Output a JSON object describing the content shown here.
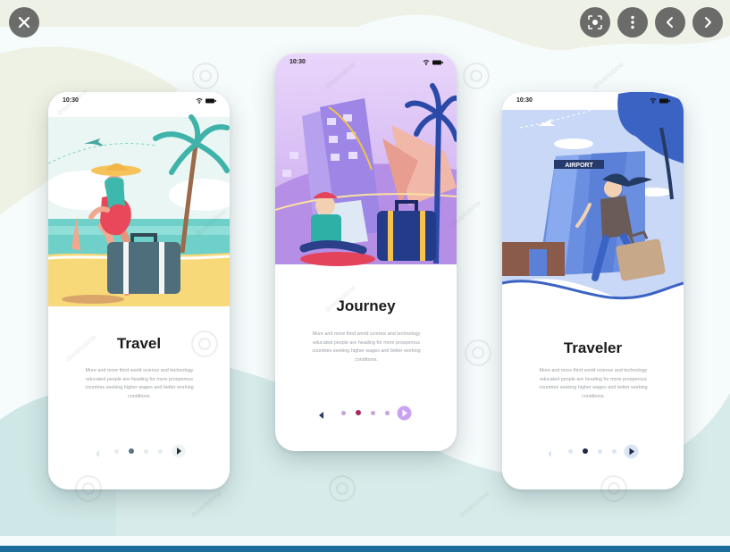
{
  "viewer": {
    "close_icon": "close-icon",
    "lens_icon": "visual-search-icon",
    "more_icon": "more-vert-icon",
    "prev_icon": "chevron-left-icon",
    "next_icon": "chevron-right-icon"
  },
  "colors": {
    "accent_purple": "#8f7ad6",
    "accent_blue": "#3b63c4",
    "dark_navy": "#243b63",
    "bottom_bar": "#1a6e9e"
  },
  "watermark": {
    "text": "dreamstime"
  },
  "screens": [
    {
      "status_time": "10:30",
      "title": "Travel",
      "description": [
        "More and more third world science and technology",
        "educated people are heading for more prosperous",
        "countries seeking higher wages and better working",
        "conditions."
      ],
      "pager_active": 2
    },
    {
      "status_time": "10:30",
      "title": "Journey",
      "description": [
        "More and more third world science and technology",
        "educated people are heading for more prosperous",
        "countries seeking higher wages and better working",
        "conditions."
      ],
      "pager_active": 1
    },
    {
      "status_time": "10:30",
      "title": "Traveler",
      "description": [
        "More and more third world science and technology",
        "educated people are heading for more prosperous",
        "countries seeking higher wages and better working",
        "conditions."
      ],
      "pager_active": 1,
      "airport_sign": "AIRPORT"
    }
  ]
}
